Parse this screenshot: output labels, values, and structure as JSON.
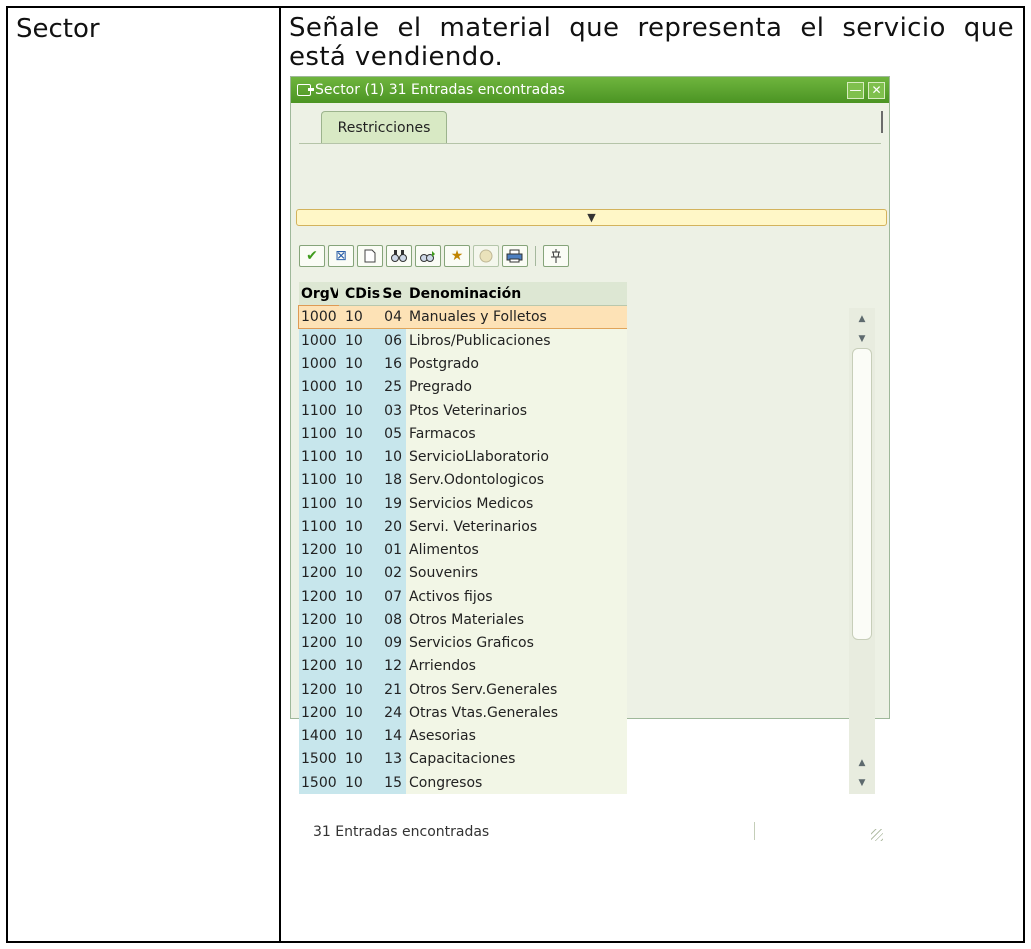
{
  "doc": {
    "left_cell": "Sector",
    "instruction": "Señale el material que representa el servicio que está vendiendo."
  },
  "window": {
    "title": "Sector (1)   31 Entradas encontradas",
    "tab_label": "Restricciones",
    "collapse_glyph": "▼",
    "status_text": "31 Entradas encontradas",
    "icons": [
      "check-icon",
      "cancel-icon",
      "new-page-icon",
      "find-icon",
      "find-next-icon",
      "favorites-icon",
      "help-icon",
      "print-icon",
      "pin-icon"
    ]
  },
  "grid": {
    "headers": {
      "org": "OrgVt",
      "cdis": "CDis",
      "se": "Se",
      "den": "Denominación"
    },
    "rows": [
      {
        "org": "1000",
        "cdis": "10",
        "se": "04",
        "den": "Manuales y Folletos"
      },
      {
        "org": "1000",
        "cdis": "10",
        "se": "06",
        "den": "Libros/Publicaciones"
      },
      {
        "org": "1000",
        "cdis": "10",
        "se": "16",
        "den": "Postgrado"
      },
      {
        "org": "1000",
        "cdis": "10",
        "se": "25",
        "den": "Pregrado"
      },
      {
        "org": "1100",
        "cdis": "10",
        "se": "03",
        "den": "Ptos Veterinarios"
      },
      {
        "org": "1100",
        "cdis": "10",
        "se": "05",
        "den": "Farmacos"
      },
      {
        "org": "1100",
        "cdis": "10",
        "se": "10",
        "den": "ServicioLlaboratorio"
      },
      {
        "org": "1100",
        "cdis": "10",
        "se": "18",
        "den": "Serv.Odontologicos"
      },
      {
        "org": "1100",
        "cdis": "10",
        "se": "19",
        "den": "Servicios Medicos"
      },
      {
        "org": "1100",
        "cdis": "10",
        "se": "20",
        "den": "Servi. Veterinarios"
      },
      {
        "org": "1200",
        "cdis": "10",
        "se": "01",
        "den": "Alimentos"
      },
      {
        "org": "1200",
        "cdis": "10",
        "se": "02",
        "den": "Souvenirs"
      },
      {
        "org": "1200",
        "cdis": "10",
        "se": "07",
        "den": "Activos fijos"
      },
      {
        "org": "1200",
        "cdis": "10",
        "se": "08",
        "den": "Otros Materiales"
      },
      {
        "org": "1200",
        "cdis": "10",
        "se": "09",
        "den": "Servicios Graficos"
      },
      {
        "org": "1200",
        "cdis": "10",
        "se": "12",
        "den": "Arriendos"
      },
      {
        "org": "1200",
        "cdis": "10",
        "se": "21",
        "den": "Otros Serv.Generales"
      },
      {
        "org": "1200",
        "cdis": "10",
        "se": "24",
        "den": "Otras Vtas.Generales"
      },
      {
        "org": "1400",
        "cdis": "10",
        "se": "14",
        "den": "Asesorias"
      },
      {
        "org": "1500",
        "cdis": "10",
        "se": "13",
        "den": "Capacitaciones"
      },
      {
        "org": "1500",
        "cdis": "10",
        "se": "15",
        "den": "Congresos"
      }
    ],
    "selected_row": 0
  },
  "colors": {
    "titlebar": "#5aa52f",
    "key_columns": "#c7e6ec",
    "selected_row": "#fde2b6"
  }
}
